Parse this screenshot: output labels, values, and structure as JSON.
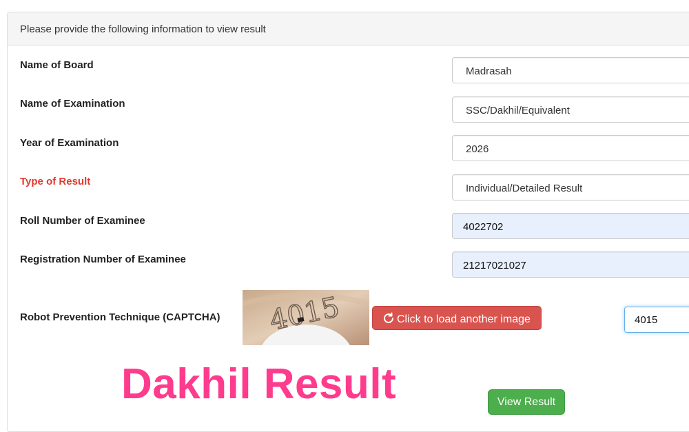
{
  "panel": {
    "heading": "Please provide the following information to view result"
  },
  "form": {
    "rows": [
      {
        "label": "Name of Board",
        "value": "Madrasah"
      },
      {
        "label": "Name of Examination",
        "value": "SSC/Dakhil/Equivalent"
      },
      {
        "label": "Year of Examination",
        "value": "2026"
      },
      {
        "label": "Type of Result",
        "value": "Individual/Detailed Result"
      },
      {
        "label": "Roll Number of Examinee",
        "value": "4022702"
      },
      {
        "label": "Registration Number of Examinee",
        "value": "21217021027"
      }
    ],
    "captcha": {
      "label": "Robot Prevention Technique (CAPTCHA)",
      "image_text": "4015",
      "reload_label": "Click to load another image",
      "input_value": "4015"
    },
    "submit_label": "View Result"
  },
  "overlay": {
    "watermark": "Dakhil Result"
  },
  "colors": {
    "required_label": "#e03a2f",
    "reload_button": "#d9534f",
    "submit_button": "#4cae4c",
    "watermark": "#ff3b8d",
    "autofill_bg": "#e8f0fe"
  },
  "icons": {
    "reload": "refresh-icon"
  }
}
